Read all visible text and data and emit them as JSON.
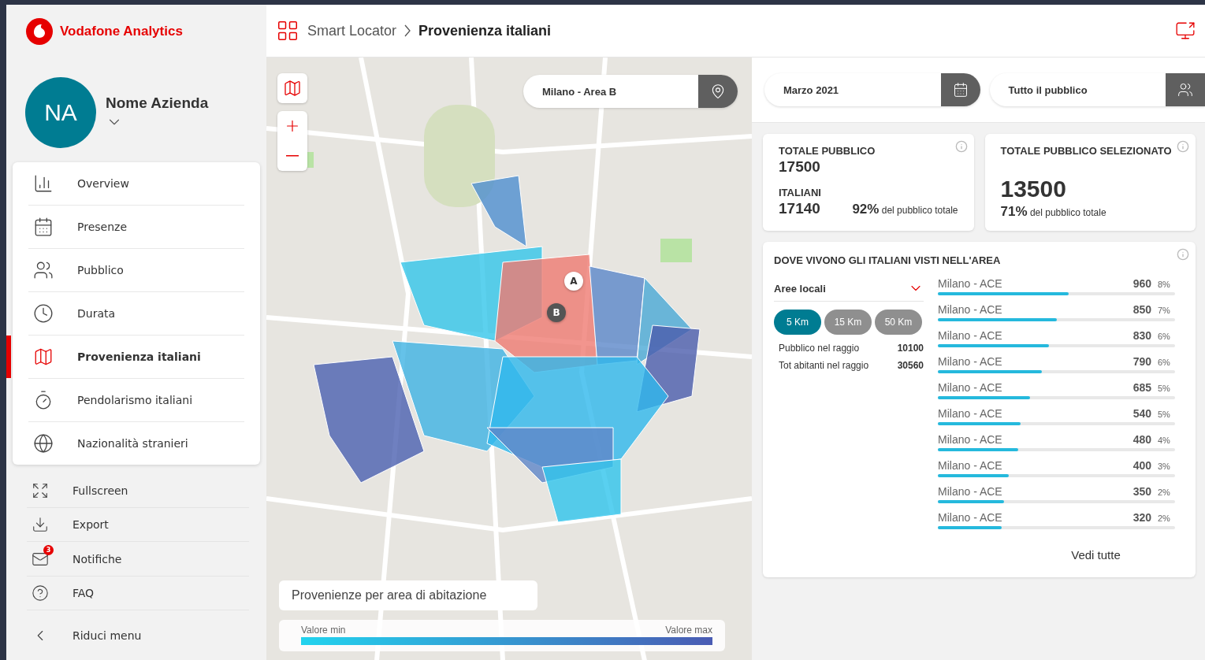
{
  "app": {
    "title": "Vodafone Analytics"
  },
  "profile": {
    "initials": "NA",
    "name": "Nome Azienda"
  },
  "menu": [
    {
      "label": "Overview",
      "selected": false
    },
    {
      "label": "Presenze",
      "selected": false
    },
    {
      "label": "Pubblico",
      "selected": false
    },
    {
      "label": "Durata",
      "selected": false
    },
    {
      "label": "Provenienza italiani",
      "selected": true
    },
    {
      "label": "Pendolarismo italiani",
      "selected": false
    },
    {
      "label": "Nazionalità stranieri",
      "selected": false
    }
  ],
  "utility_menu": [
    {
      "label": "Fullscreen"
    },
    {
      "label": "Export"
    },
    {
      "label": "Notifiche",
      "badge": "3"
    },
    {
      "label": "FAQ"
    },
    {
      "label": "Riduci menu"
    }
  ],
  "breadcrumb": [
    {
      "label": "Smart Locator",
      "selected": false
    },
    {
      "label": "Provenienza italiani",
      "selected": true
    }
  ],
  "map": {
    "search": {
      "value": "Milano - Area B"
    },
    "markers": [
      {
        "label": "A"
      },
      {
        "label": "B"
      }
    ],
    "legend": {
      "title": "Provenienze per area di abitazione",
      "min_label": "Valore min",
      "max_label": "Valore max"
    }
  },
  "filters": [
    {
      "value": "Marzo 2021"
    },
    {
      "value": "Tutto il pubblico"
    }
  ],
  "totals": {
    "title": "TOTALE PUBBLICO",
    "value": "17500",
    "sub_title": "ITALIANI",
    "sub_value": "17140",
    "percent": "92%",
    "percent_text": "del pubblico totale"
  },
  "selected_totals": {
    "title": "TOTALE PUBBLICO SELEZIONATO",
    "value": "13500",
    "percent": "71%",
    "percent_text": "del pubblico totale"
  },
  "origins": {
    "title": "DOVE VIVONO GLI ITALIANI VISTI NELL'AREA",
    "dropdown": {
      "value": "Aree locali"
    },
    "radius": [
      {
        "label": "5 Km",
        "selected": true
      },
      {
        "label": "15 Km",
        "selected": false
      },
      {
        "label": "50 Km",
        "selected": false
      }
    ],
    "stats": [
      {
        "label": "Pubblico nel raggio",
        "value": "10100"
      },
      {
        "label": "Tot abitanti nel raggio",
        "value": "30560"
      }
    ],
    "rows": [
      {
        "name": "Milano - ACE",
        "value": "960",
        "percent": "8%",
        "level": 0.55
      },
      {
        "name": "Milano - ACE",
        "value": "850",
        "percent": "7%",
        "level": 0.5
      },
      {
        "name": "Milano - ACE",
        "value": "830",
        "percent": "6%",
        "level": 0.47
      },
      {
        "name": "Milano - ACE",
        "value": "790",
        "percent": "6%",
        "level": 0.44
      },
      {
        "name": "Milano - ACE",
        "value": "685",
        "percent": "5%",
        "level": 0.39
      },
      {
        "name": "Milano - ACE",
        "value": "540",
        "percent": "5%",
        "level": 0.35
      },
      {
        "name": "Milano - ACE",
        "value": "480",
        "percent": "4%",
        "level": 0.34
      },
      {
        "name": "Milano - ACE",
        "value": "400",
        "percent": "3%",
        "level": 0.3
      },
      {
        "name": "Milano - ACE",
        "value": "350",
        "percent": "2%",
        "level": 0.28
      },
      {
        "name": "Milano - ACE",
        "value": "320",
        "percent": "2%",
        "level": 0.27
      }
    ],
    "link": "Vedi tutte"
  }
}
